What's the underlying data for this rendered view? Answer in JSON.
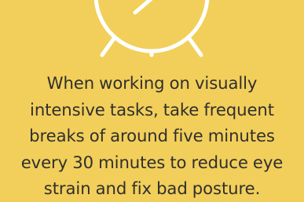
{
  "background_color": "#f2cf5a",
  "icon_color": "#ffffff",
  "text_color": "#2f2f2f",
  "icon": "alarm-clock-icon",
  "tip": {
    "line1": "When working on visually",
    "line2": "intensive tasks, take frequent",
    "line3": "breaks of around five minutes",
    "line4": "every 30 minutes to reduce eye",
    "line5": "strain and fix bad posture."
  }
}
